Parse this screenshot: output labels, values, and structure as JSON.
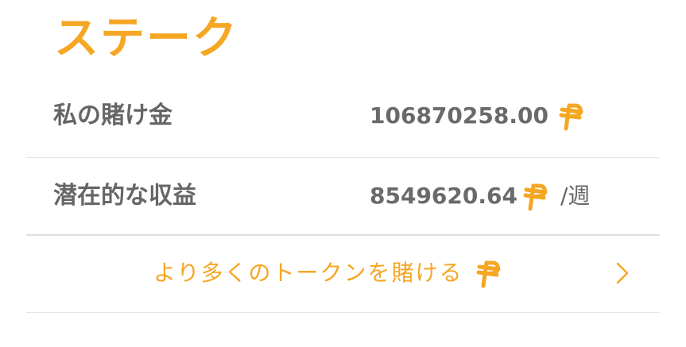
{
  "page": {
    "title": "ステーク"
  },
  "stake_rows": [
    {
      "label": "私の賭け金",
      "value": "106870258.00",
      "unit": ""
    },
    {
      "label": "潜在的な収益",
      "value": "8549620.64",
      "unit": "/週"
    }
  ],
  "stake_more": {
    "label": "より多くのトークンを賭ける"
  },
  "icons": {
    "token": "token-coin-icon",
    "chevron": "chevron-right-icon"
  },
  "colors": {
    "accent": "#F5A623",
    "text": "#666666"
  }
}
